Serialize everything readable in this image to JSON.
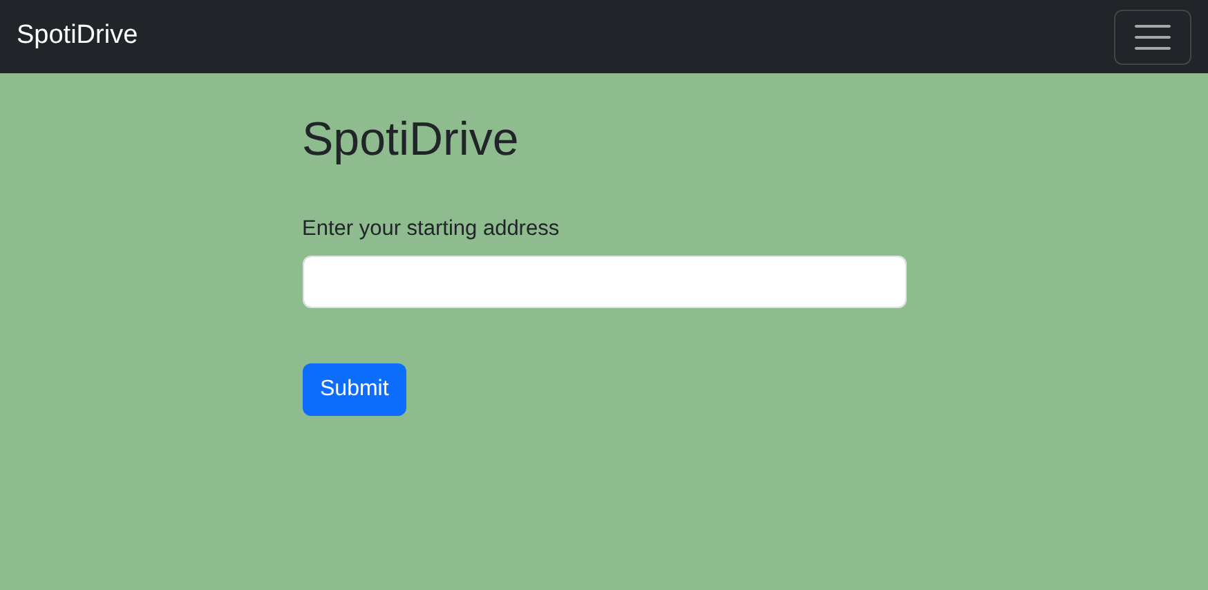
{
  "navbar": {
    "brand": "SpotiDrive"
  },
  "heading": "SpotiDrive",
  "form": {
    "label": "Enter your starting address",
    "button": "Submit"
  }
}
